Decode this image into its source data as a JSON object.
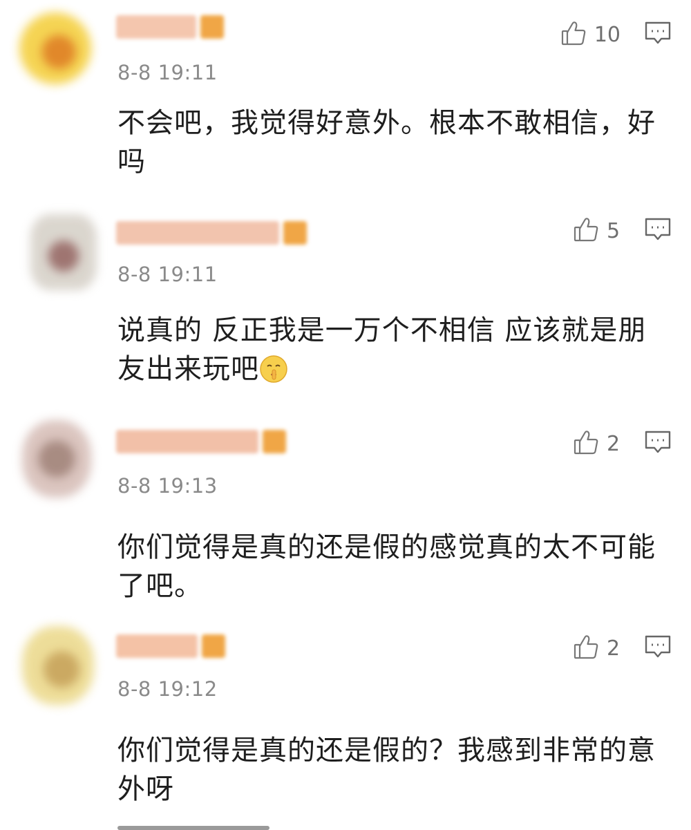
{
  "comments": [
    {
      "timestamp": "8-8 19:11",
      "likes": "10",
      "content": "不会吧，我觉得好意外。根本不敢相信，好吗",
      "avatar_colors": [
        "#f5d24a",
        "#e0821f"
      ],
      "name_color": "#f4c6ae",
      "badge_color": "#f0a646"
    },
    {
      "timestamp": "8-8 19:11",
      "likes": "5",
      "content": "说真的 反正我是一万个不相信 应该就是朋友出来玩吧",
      "emoji_name": "shush-face-emoji",
      "avatar_colors": [
        "#d9d4cc",
        "#9a6e6a"
      ],
      "name_color": "#f2c4ae",
      "badge_color": "#f0a646"
    },
    {
      "timestamp": "8-8 19:13",
      "likes": "2",
      "content": "你们觉得是真的还是假的感觉真的太不可能了吧。",
      "avatar_colors": [
        "#d9c2bc",
        "#a4867c"
      ],
      "name_color": "#f2c0a8",
      "badge_color": "#f0a646"
    },
    {
      "timestamp": "8-8 19:12",
      "likes": "2",
      "content": "你们觉得是真的还是假的？我感到非常的意外呀",
      "avatar_colors": [
        "#eddc94",
        "#c9a55a"
      ],
      "name_color": "#f4c2a6",
      "badge_color": "#f0a646"
    }
  ],
  "icons": {
    "like": "thumbs-up-icon",
    "reply": "comment-icon"
  }
}
